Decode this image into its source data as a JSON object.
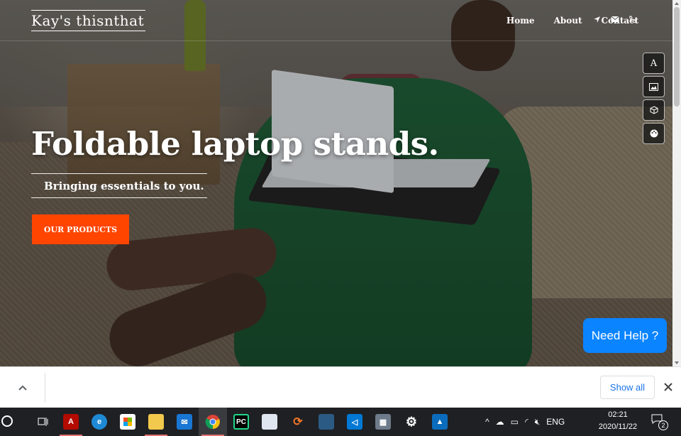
{
  "brand": "Kay's thisnthat",
  "nav": {
    "home": "Home",
    "about": "About",
    "contact": "Contact"
  },
  "nav_icons": [
    "location-arrow-icon",
    "envelope-icon",
    "phone-icon"
  ],
  "side_tools": [
    "font-icon",
    "image-icon",
    "cube-icon",
    "palette-icon"
  ],
  "side_tool_font_glyph": "A",
  "hero": {
    "headline": "Foldable laptop stands.",
    "tagline": "Bringing essentials to you.",
    "cta": "OUR PRODUCTS"
  },
  "help_button": "Need Help ?",
  "download_bar": {
    "show_all": "Show all",
    "close": "✕",
    "expand": "⌃"
  },
  "taskbar": {
    "apps": [
      "task-view",
      "acrobat",
      "edge",
      "store",
      "file-explorer",
      "mail",
      "chrome",
      "pycharm",
      "paint",
      "jupyter",
      "mysql-workbench",
      "vscode",
      "calculator",
      "settings",
      "photos"
    ],
    "tray": {
      "language": "ENG"
    },
    "clock": {
      "time": "02:21",
      "date": "2020/11/22"
    },
    "notifications": "2"
  },
  "colors": {
    "accent": "#ff4500",
    "help": "#0a84ff",
    "taskbar": "#1f2023"
  }
}
